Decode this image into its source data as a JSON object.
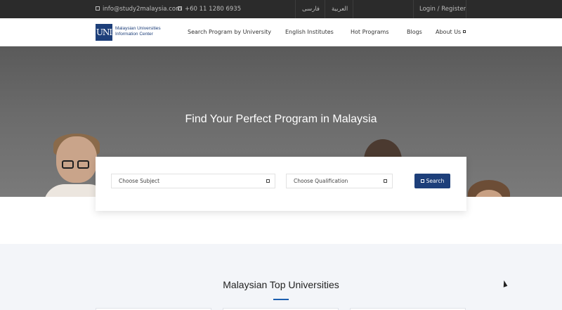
{
  "topbar": {
    "email": "info@study2malaysia.com",
    "phone": "+60 11 1280 6935",
    "lang_fa": "فارسی",
    "lang_ar": "العربية",
    "login": "Login",
    "divider": "/",
    "register": "Register"
  },
  "logo": {
    "mark": "UNI",
    "line1": "Malaysian Universities",
    "line2": "Information Center"
  },
  "nav": {
    "items": [
      {
        "label": "Search Program by University"
      },
      {
        "label": "English Institutes"
      },
      {
        "label": "Hot Programs"
      },
      {
        "label": "Blogs"
      },
      {
        "label": "About Us"
      }
    ]
  },
  "hero": {
    "title": "Find Your Perfect Program in Malaysia"
  },
  "search": {
    "subject_value": "Choose Subject",
    "qualification_value": "Choose Qualification",
    "button_label": "Search"
  },
  "section": {
    "title": "Malaysian Top Universities"
  },
  "colors": {
    "brand": "#1d3f7a",
    "accent": "#1d5fb0",
    "topbar": "#2b2b2b"
  }
}
